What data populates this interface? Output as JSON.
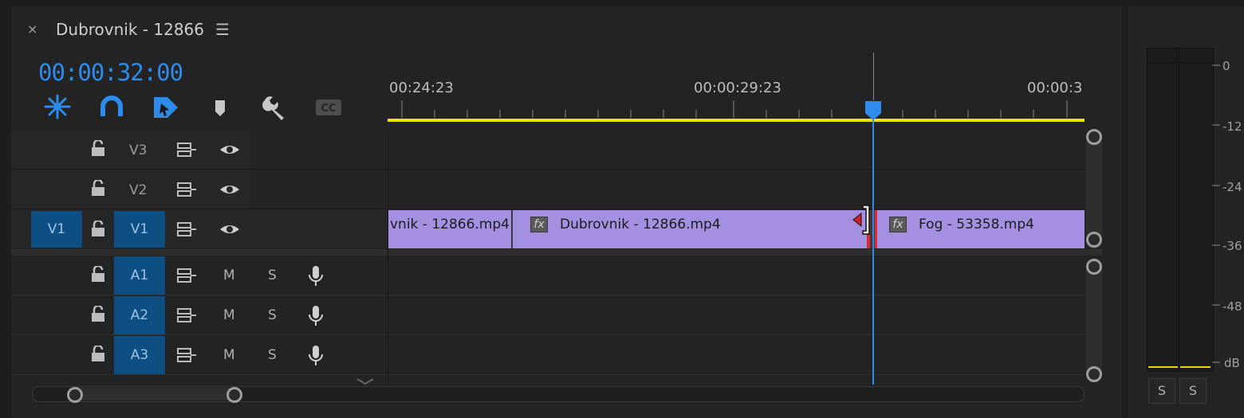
{
  "panel": {
    "close_glyph": "×",
    "title": "Dubrovnik - 12866",
    "menu_glyph": "☰",
    "timecode": "00:00:32:00"
  },
  "toolbar": {
    "icons": [
      "snap-insert-icon",
      "magnet-icon",
      "linked-selection-icon",
      "marker-icon",
      "wrench-icon",
      "captions-icon"
    ],
    "cc_label": "CC"
  },
  "ruler": {
    "labels": [
      "00:24:23",
      "00:00:29:23",
      "00:00:3"
    ]
  },
  "tracks": {
    "video": [
      {
        "target": "",
        "label": "V3"
      },
      {
        "target": "",
        "label": "V2"
      },
      {
        "target": "V1",
        "label": "V1"
      }
    ],
    "audio": [
      {
        "label": "A1",
        "m": "M",
        "s": "S"
      },
      {
        "label": "A2",
        "m": "M",
        "s": "S"
      },
      {
        "label": "A3",
        "m": "M",
        "s": "S"
      }
    ]
  },
  "clips": [
    {
      "name": "vnik - 12866.mp4",
      "fx": ""
    },
    {
      "name": "Dubrovnik - 12866.mp4",
      "fx": "fx"
    },
    {
      "name": "Fog - 53358.mp4",
      "fx": "fx"
    }
  ],
  "meter": {
    "scale": [
      "0",
      "-12",
      "-24",
      "-36",
      "-48",
      "dB"
    ],
    "solo_left": "S",
    "solo_right": "S"
  },
  "colors": {
    "accent": "#2d8ceb",
    "clip": "#a48fe0",
    "work_area": "#f0e200",
    "track_target": "#0d4f83",
    "edit_point": "#e0262f"
  }
}
